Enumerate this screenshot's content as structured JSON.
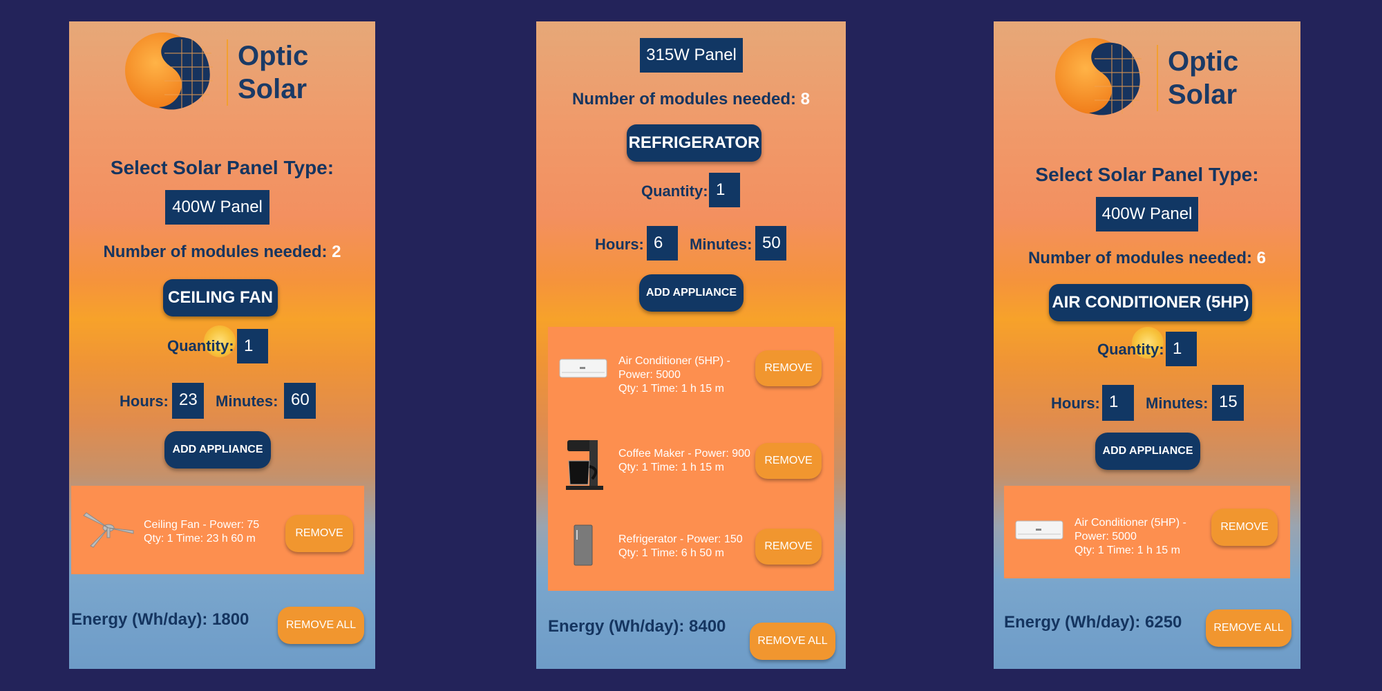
{
  "screens": [
    {
      "logo": {
        "line1": "Optic",
        "line2": "Solar"
      },
      "heading": "Select Solar Panel Type:",
      "panel": "400W Panel",
      "modules_label": "Number of modules needed:",
      "modules_value": "2",
      "appliance": "CEILING FAN",
      "quantity_label": "Quantity:",
      "quantity": "1",
      "hours_label": "Hours:",
      "hours": "23",
      "minutes_label": "Minutes:",
      "minutes": "60",
      "add_label": "ADD APPLIANCE",
      "items": [
        {
          "icon": "ceiling-fan-icon",
          "line1": "Ceiling Fan - Power: 75",
          "line2": "Qty: 1 Time: 23 h 60 m",
          "remove": "REMOVE"
        }
      ],
      "energy": "Energy (Wh/day): 1800",
      "remove_all": "REMOVE ALL"
    },
    {
      "panel": "315W Panel",
      "modules_label": "Number of modules needed:",
      "modules_value": "8",
      "appliance": "REFRIGERATOR",
      "quantity_label": "Quantity:",
      "quantity": "1",
      "hours_label": "Hours:",
      "hours": "6",
      "minutes_label": "Minutes:",
      "minutes": "50",
      "add_label": "ADD APPLIANCE",
      "items": [
        {
          "icon": "air-conditioner-icon",
          "line1": "Air Conditioner (5HP) -",
          "line2": "Power: 5000",
          "line3": "Qty: 1 Time: 1 h 15 m",
          "remove": "REMOVE"
        },
        {
          "icon": "coffee-maker-icon",
          "line1": "Coffee Maker - Power: 900",
          "line2": "Qty: 1 Time: 1 h 15 m",
          "remove": "REMOVE"
        },
        {
          "icon": "refrigerator-icon",
          "line1": "Refrigerator - Power: 150",
          "line2": "Qty: 1 Time: 6 h 50 m",
          "remove": "REMOVE"
        }
      ],
      "energy": "Energy (Wh/day): 8400",
      "remove_all": "REMOVE ALL"
    },
    {
      "logo": {
        "line1": "Optic",
        "line2": "Solar"
      },
      "heading": "Select Solar Panel Type:",
      "panel": "400W Panel",
      "modules_label": "Number of modules needed:",
      "modules_value": "6",
      "appliance": "AIR CONDITIONER (5HP)",
      "quantity_label": "Quantity:",
      "quantity": "1",
      "hours_label": "Hours:",
      "hours": "1",
      "minutes_label": "Minutes:",
      "minutes": "15",
      "add_label": "ADD APPLIANCE",
      "items": [
        {
          "icon": "air-conditioner-icon",
          "line1": "Air Conditioner (5HP) -",
          "line2": "Power: 5000",
          "line3": "Qty: 1 Time: 1 h 15 m",
          "remove": "REMOVE"
        }
      ],
      "energy": "Energy (Wh/day): 6250",
      "remove_all": "REMOVE ALL"
    }
  ]
}
